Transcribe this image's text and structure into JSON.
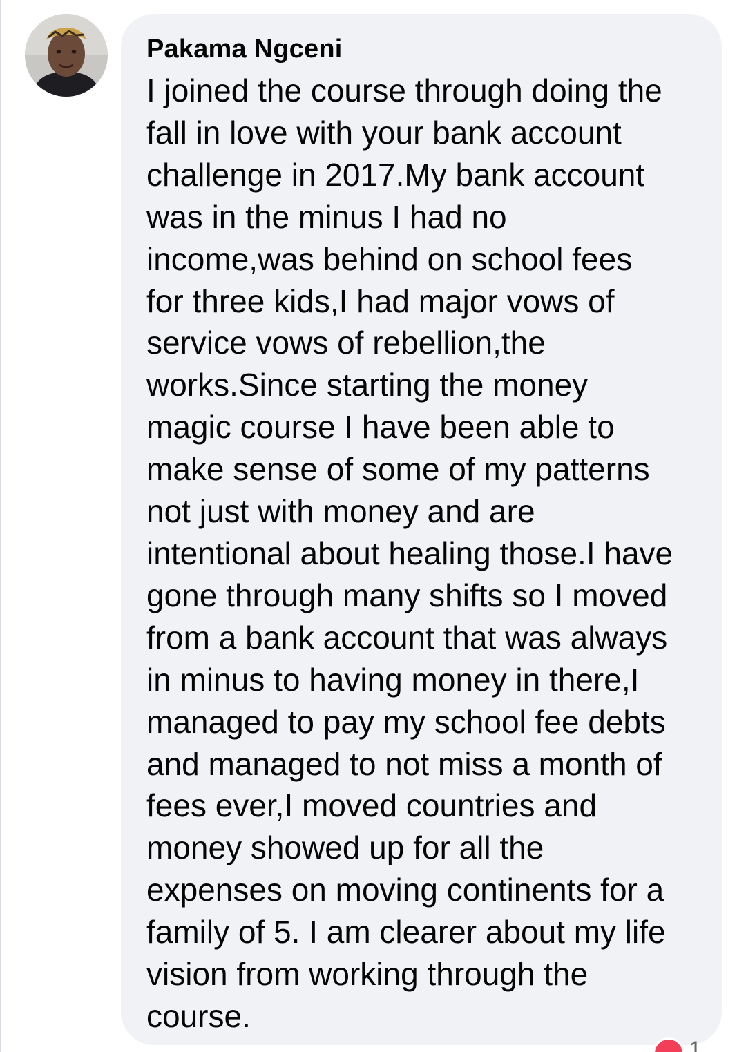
{
  "comment": {
    "author": "Pakama Ngceni",
    "lines": [
      "I joined the course through doing the",
      "fall in love with your bank account",
      "challenge in 2017.My bank account",
      "was in the minus I had no",
      "income,was behind on school fees",
      "for three kids,I had major vows of",
      "service vows of rebellion,the",
      "works.Since starting the money",
      "magic course I have been able to",
      "make sense of some of my patterns",
      "not just with money and are",
      "intentional about healing those.I have",
      "gone through many shifts so I moved",
      "from a bank account that was always",
      "in minus to having money in there,I",
      "managed to pay my school fee debts",
      "and managed to not miss a month of",
      "fees ever,I moved countries and",
      "money showed up for all the",
      "expenses on moving continents for a",
      "family of 5. I am clearer about my life",
      "vision from working through the",
      "course."
    ]
  },
  "reactions": {
    "icon": "love-reaction-icon",
    "count": "1",
    "color": "#f33e58"
  },
  "colors": {
    "bubble_background": "#f0f2f5",
    "text": "#050505"
  }
}
